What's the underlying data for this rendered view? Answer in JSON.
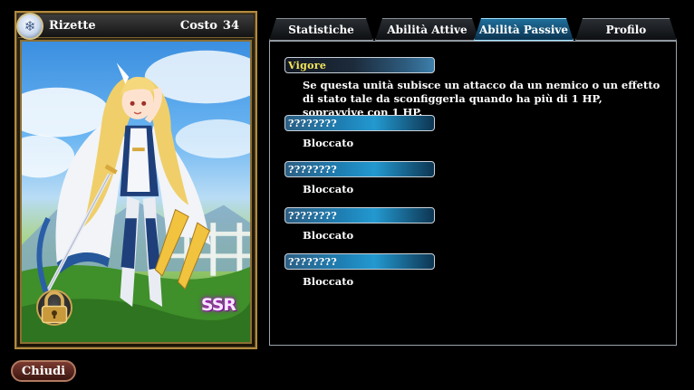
{
  "card": {
    "name": "Rizette",
    "cost_label": "Costo",
    "cost_value": "34",
    "element_icon": "snowflake-icon",
    "rarity": "SSR",
    "lock_icon": "padlock-icon"
  },
  "tabs": [
    {
      "label": "Statistiche",
      "active": false
    },
    {
      "label": "Abilità Attive",
      "active": false
    },
    {
      "label": "Abilità Passive",
      "active": true
    },
    {
      "label": "Profilo",
      "active": false
    }
  ],
  "abilities": [
    {
      "name": "Vigore",
      "description": "Se questa unità subisce un attacco da un nemico o un effetto di stato tale da sconfiggerla quando ha più di 1 HP, sopravvive con 1 HP."
    },
    {
      "name": "????????",
      "description": "Bloccato"
    },
    {
      "name": "????????",
      "description": "Bloccato"
    },
    {
      "name": "????????",
      "description": "Bloccato"
    },
    {
      "name": "????????",
      "description": "Bloccato"
    }
  ],
  "footer": {
    "close_label": "Chiudi"
  },
  "colors": {
    "active_tab": "#1f6f9c",
    "ability_name_gold": "#f4e65a",
    "ability_bar_blue": "#2399d0",
    "card_border_gold": "#b08a3e"
  }
}
